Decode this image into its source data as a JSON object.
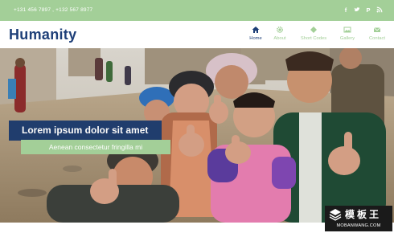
{
  "topbar": {
    "phones": "+131 456 7897 , +132 567 8977",
    "social_icons": [
      "facebook-icon",
      "twitter-icon",
      "pinterest-icon",
      "rss-icon"
    ],
    "color": "#a3cf98"
  },
  "header": {
    "logo": "Humanity",
    "logo_color": "#1e3f78",
    "nav": [
      {
        "label": "Home",
        "icon": "home-icon",
        "active": true
      },
      {
        "label": "About",
        "icon": "gear-icon",
        "active": false
      },
      {
        "label": "Short Codes",
        "icon": "diamond-icon",
        "active": false
      },
      {
        "label": "Gallery",
        "icon": "image-icon",
        "active": false
      },
      {
        "label": "Contact",
        "icon": "envelope-icon",
        "active": false
      }
    ]
  },
  "hero": {
    "title": "Lorem ipsum dolor sit amet",
    "subtitle": "Aenean consectetur fringilla mi"
  },
  "watermark": {
    "title": "模板王",
    "url": "MOBANWANG.COM"
  }
}
